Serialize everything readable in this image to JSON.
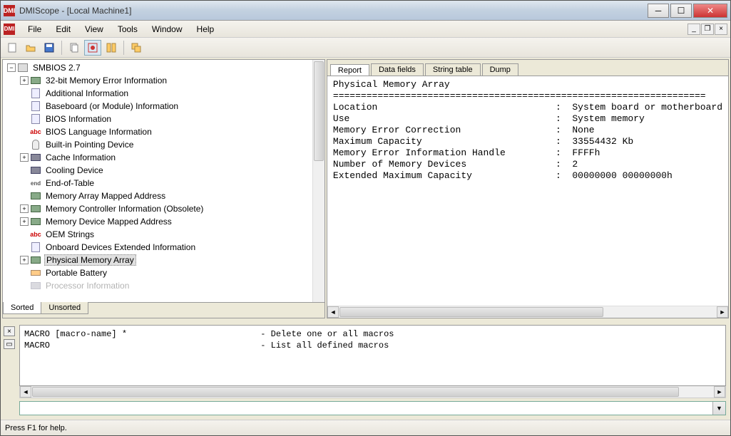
{
  "titlebar": {
    "app": "DMIScope",
    "doc": "[Local Machine1]"
  },
  "menu": [
    "File",
    "Edit",
    "View",
    "Tools",
    "Window",
    "Help"
  ],
  "toolbar_icons": [
    "new-doc",
    "open",
    "save",
    "copy",
    "highlight",
    "tile",
    "cascade"
  ],
  "tree": {
    "root": "SMBIOS 2.7",
    "items": [
      {
        "label": "32-bit Memory Error Information",
        "exp": "+",
        "icon": "chip"
      },
      {
        "label": "Additional Information",
        "icon": "doc"
      },
      {
        "label": "Baseboard (or Module) Information",
        "icon": "doc"
      },
      {
        "label": "BIOS Information",
        "icon": "doc"
      },
      {
        "label": "BIOS Language Information",
        "icon": "abc"
      },
      {
        "label": "Built-in Pointing Device",
        "icon": "mouse"
      },
      {
        "label": "Cache Information",
        "exp": "+",
        "icon": "chipb"
      },
      {
        "label": "Cooling Device",
        "icon": "chipb"
      },
      {
        "label": "End-of-Table",
        "icon": "end"
      },
      {
        "label": "Memory Array Mapped Address",
        "icon": "chip"
      },
      {
        "label": "Memory Controller Information (Obsolete)",
        "exp": "+",
        "icon": "chip"
      },
      {
        "label": "Memory Device Mapped Address",
        "exp": "+",
        "icon": "chip"
      },
      {
        "label": "OEM Strings",
        "icon": "abc"
      },
      {
        "label": "Onboard Devices Extended Information",
        "icon": "doc"
      },
      {
        "label": "Physical Memory Array",
        "exp": "+",
        "icon": "chip",
        "selected": true
      },
      {
        "label": "Portable Battery",
        "icon": "bat"
      },
      {
        "label": "Processor Information",
        "icon": "chipb",
        "partial": true
      }
    ]
  },
  "bottom_tabs": [
    "Sorted",
    "Unsorted"
  ],
  "top_tabs": [
    "Report",
    "Data fields",
    "String table",
    "Dump"
  ],
  "report": {
    "title": "Physical Memory Array",
    "rows": [
      {
        "k": "Location",
        "v": "System board or motherboard"
      },
      {
        "k": "Use",
        "v": "System memory"
      },
      {
        "k": "Memory Error Correction",
        "v": "None"
      },
      {
        "k": "Maximum Capacity",
        "v": "33554432 Kb"
      },
      {
        "k": "Memory Error Information Handle",
        "v": "FFFFh"
      },
      {
        "k": "Number of Memory Devices",
        "v": "2"
      },
      {
        "k": "Extended Maximum Capacity",
        "v": "00000000 00000000h"
      }
    ]
  },
  "macro": [
    {
      "cmd": "MACRO [macro-name] *",
      "desc": "- Delete one or all macros"
    },
    {
      "cmd": "MACRO",
      "desc": "- List all defined macros"
    }
  ],
  "status": "Press F1 for help."
}
